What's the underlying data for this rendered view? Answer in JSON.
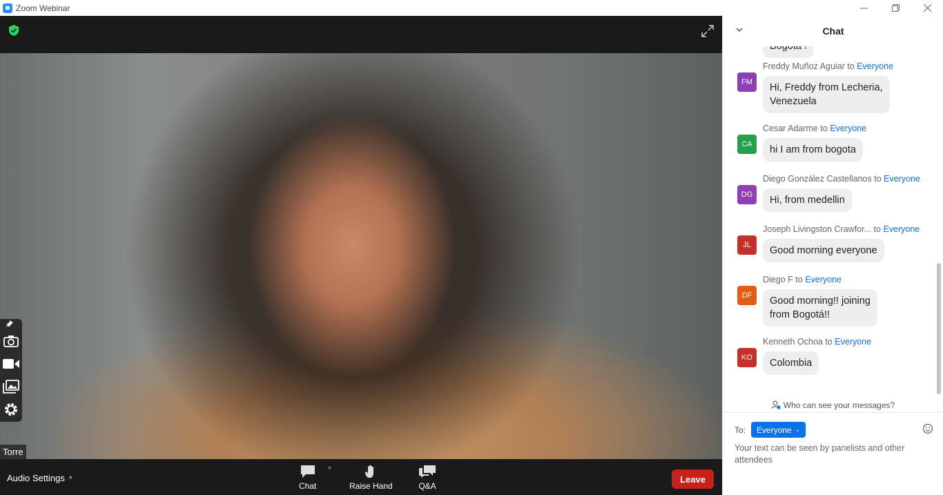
{
  "window": {
    "title": "Zoom Webinar",
    "controls": [
      "minimize",
      "restore",
      "close"
    ]
  },
  "video": {
    "participant_name": "Torre"
  },
  "toolbar": {
    "audio_settings": "Audio Settings",
    "chat": "Chat",
    "raise_hand": "Raise Hand",
    "qa": "Q&A",
    "leave": "Leave"
  },
  "chat": {
    "title": "Chat",
    "partial_message": "Bogota !",
    "messages": [
      {
        "sender": "Freddy Muñoz Aguiar",
        "to_word": "to",
        "recipient": "Everyone",
        "initials": "FM",
        "color": "#8e3fb3",
        "text_lines": [
          "Hi, Freddy from Lecheria,",
          "Venezuela"
        ]
      },
      {
        "sender": "Cesar Adarme",
        "to_word": "to",
        "recipient": "Everyone",
        "initials": "CA",
        "color": "#22a04b",
        "text_lines": [
          "hi I am from bogota"
        ]
      },
      {
        "sender": "Diego González Castellanos",
        "to_word": "to",
        "recipient": "Everyone",
        "initials": "DG",
        "color": "#8e3fb3",
        "text_lines": [
          "Hi, from medellin"
        ]
      },
      {
        "sender": "Joseph Livingston Crawfor...",
        "to_word": "to",
        "recipient": "Everyone",
        "initials": "JL",
        "color": "#c6302b",
        "text_lines": [
          "Good morning everyone"
        ]
      },
      {
        "sender": "Diego F",
        "to_word": "to",
        "recipient": "Everyone",
        "initials": "DF",
        "color": "#e35e14",
        "text_lines": [
          "Good morning!! joining",
          "from Bogotá!!"
        ]
      },
      {
        "sender": "Kenneth Ochoa",
        "to_word": "to",
        "recipient": "Everyone",
        "initials": "KO",
        "color": "#c6302b",
        "text_lines": [
          "Colombia"
        ]
      }
    ],
    "who_can_see": "Who can see your messages?",
    "to_label": "To:",
    "to_value": "Everyone",
    "input_hint": "Your text can be seen by panelists and other attendees"
  },
  "colors": {
    "accent": "#0e71eb",
    "leave": "#c8211a",
    "toolbar_bg": "#1a1a1a"
  }
}
